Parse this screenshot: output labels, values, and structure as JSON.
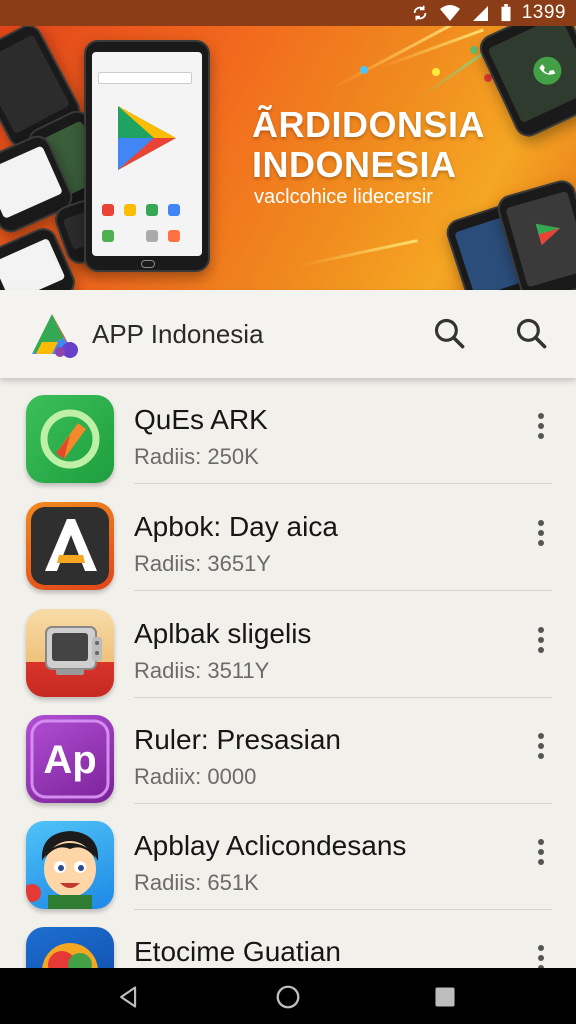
{
  "status_bar": {
    "time": "1399",
    "icons": [
      "sync-icon",
      "wifi-icon",
      "signal-icon",
      "battery-icon"
    ]
  },
  "banner": {
    "title_line1": "ÃRDIDONSIA",
    "title_line2": "INDONESIA",
    "tagline": "vaclcohice lidecersir"
  },
  "app_bar": {
    "title": "APP Indonesia",
    "logo_icon": "play-store-logo-icon",
    "search_icons": [
      "search-icon",
      "search-icon"
    ]
  },
  "apps": [
    {
      "name": "QuEs ARK",
      "meta": "Radiis: 250K",
      "icon": "green-compass-icon",
      "colors": [
        "#27b24a",
        "#7ed957"
      ]
    },
    {
      "name": "Apbok: Day aica",
      "meta": "Radiis: 3651Y",
      "icon": "letter-a-icon",
      "colors": [
        "#333333",
        "#f5a623"
      ]
    },
    {
      "name": "Aplbak sligelis",
      "meta": "Radiis: 3511Y",
      "icon": "tv-icon",
      "colors": [
        "#f2d29a",
        "#d9342b"
      ]
    },
    {
      "name": "Ruler: Presasian",
      "meta": "Radiix: 0000",
      "icon": "ap-letters-icon",
      "colors": [
        "#8e2fb0",
        "#b94fd6"
      ]
    },
    {
      "name": "Apblay Aclicondesans",
      "meta": "Radiis: 651K",
      "icon": "cartoon-face-icon",
      "colors": [
        "#2aa9e0",
        "#ffd25a"
      ]
    },
    {
      "name": "Etocime Guatian",
      "meta": "",
      "icon": "colorful-circle-icon",
      "colors": [
        "#1d6fd1",
        "#f5a623"
      ]
    }
  ],
  "nav": {
    "back_icon": "back-icon",
    "home_icon": "home-icon",
    "recents_icon": "recents-icon"
  },
  "colors": {
    "status_bar": "#8a3d16",
    "banner_orange": "#f26a1e",
    "app_bar_bg": "#f4f3ef",
    "list_bg": "#f2f0eb"
  }
}
